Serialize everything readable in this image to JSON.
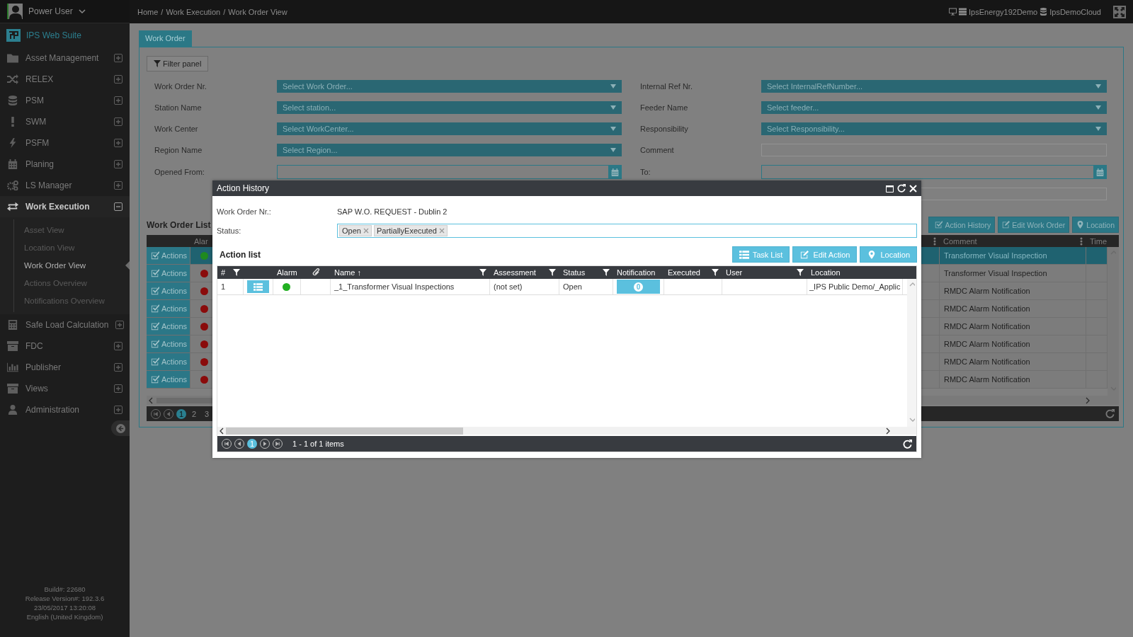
{
  "user": {
    "name": "Power User"
  },
  "app": {
    "name": "IPS Web Suite"
  },
  "sidebar": {
    "items": [
      {
        "label": "Asset Management",
        "expanded": false
      },
      {
        "label": "RELEX",
        "expanded": false
      },
      {
        "label": "PSM",
        "expanded": false
      },
      {
        "label": "SWM",
        "expanded": false
      },
      {
        "label": "PSFM",
        "expanded": false
      },
      {
        "label": "Planing",
        "expanded": false
      },
      {
        "label": "LS Manager",
        "expanded": false
      },
      {
        "label": "Work Execution",
        "expanded": true,
        "children": [
          {
            "label": "Asset View",
            "selected": false
          },
          {
            "label": "Location View",
            "selected": false
          },
          {
            "label": "Work Order View",
            "selected": true
          },
          {
            "label": "Actions Overview",
            "selected": false
          },
          {
            "label": "Notifications Overview",
            "selected": false
          }
        ]
      },
      {
        "label": "Safe Load Calculation",
        "expanded": false
      },
      {
        "label": "FDC",
        "expanded": false
      },
      {
        "label": "Publisher",
        "expanded": false
      },
      {
        "label": "Views",
        "expanded": false
      },
      {
        "label": "Administration",
        "expanded": false
      }
    ]
  },
  "footer": [
    "Build#: 22680",
    "Release Version#: 192.3.6",
    "23/05/2017 13:20:08",
    "English (United Kingdom)"
  ],
  "breadcrumb": [
    {
      "label": "Home",
      "separator": "/"
    },
    {
      "label": "Work Execution",
      "separator": "/"
    },
    {
      "label": "Work Order View"
    }
  ],
  "environment": {
    "client": "IpsEnergy192Demo",
    "database": "IpsDemoCloud"
  },
  "tabs": [
    {
      "label": "Work Order",
      "selected": true
    }
  ],
  "filter_panel": {
    "button": "Filter panel",
    "rows": [
      {
        "left": {
          "label": "Work Order Nr.",
          "kind": "select",
          "placeholder": "Select Work Order..."
        },
        "right": {
          "label": "Internal Ref Nr.",
          "kind": "select",
          "placeholder": "Select InternalRefNumber..."
        }
      },
      {
        "left": {
          "label": "Station Name",
          "kind": "select",
          "placeholder": "Select station..."
        },
        "right": {
          "label": "Feeder Name",
          "kind": "select",
          "placeholder": "Select feeder..."
        }
      },
      {
        "left": {
          "label": "Work Center",
          "kind": "select",
          "placeholder": "Select WorkCenter..."
        },
        "right": {
          "label": "Responsibility",
          "kind": "select",
          "placeholder": "Select Responsibility..."
        }
      },
      {
        "left": {
          "label": "Region Name",
          "kind": "select",
          "placeholder": "Select Region..."
        },
        "right": {
          "label": "Comment",
          "kind": "text"
        }
      },
      {
        "left": {
          "label": "Opened From:",
          "kind": "date"
        },
        "right": {
          "label": "To:",
          "kind": "date"
        }
      },
      {
        "right": {
          "kind": "text"
        }
      }
    ]
  },
  "work_order_list": {
    "title": "Work Order List",
    "buttons": [
      "Action History",
      "Edit Work Order",
      "Location"
    ],
    "columns": [
      {
        "label": "Alar"
      },
      {
        "label": "Comment"
      },
      {
        "label": "Time"
      }
    ],
    "rows": [
      {
        "action": "Actions",
        "color": "#1f8a1f",
        "comment": "Transformer Visual Inspection",
        "selected": true
      },
      {
        "action": "Actions",
        "color": "#8a0b0b",
        "comment": "Transformer Visual Inspection",
        "selected": false
      },
      {
        "action": "Actions",
        "color": "#8a0b0b",
        "comment": "RMDC Alarm Notification",
        "selected": false
      },
      {
        "action": "Actions",
        "color": "#8a0b0b",
        "comment": "RMDC Alarm Notification",
        "selected": false
      },
      {
        "action": "Actions",
        "color": "#8a0b0b",
        "comment": "RMDC Alarm Notification",
        "selected": false
      },
      {
        "action": "Actions",
        "color": "#8a0b0b",
        "comment": "RMDC Alarm Notification",
        "selected": false
      },
      {
        "action": "Actions",
        "color": "#8a0b0b",
        "comment": "RMDC Alarm Notification",
        "selected": false
      },
      {
        "action": "Actions",
        "color": "#8a0b0b",
        "comment": "RMDC Alarm Notification",
        "selected": false
      }
    ],
    "pager": {
      "pages": [
        {
          "label": "1",
          "selected": true
        },
        {
          "label": "2",
          "selected": false
        },
        {
          "label": "3",
          "selected": false
        }
      ]
    }
  },
  "dialog": {
    "title": "Action History",
    "work_order_label": "Work Order Nr.:",
    "work_order_value": "SAP W.O. REQUEST - Dublin 2",
    "status_label": "Status:",
    "status_tags": [
      "Open",
      "PartiallyExecuted"
    ],
    "action_list": {
      "title": "Action list",
      "buttons": [
        "Task List",
        "Edit Action",
        "Location"
      ],
      "columns": [
        {
          "kind": "text",
          "label": "#",
          "filter": true
        },
        {
          "kind": "blank"
        },
        {
          "kind": "text",
          "label": "Alarm",
          "filter": false
        },
        {
          "kind": "attachment"
        },
        {
          "kind": "text",
          "label": "Name",
          "sort_mark": "↑",
          "filter": true
        },
        {
          "kind": "text",
          "label": "Assessment",
          "filter": true
        },
        {
          "kind": "text",
          "label": "Status",
          "filter": true
        },
        {
          "kind": "text",
          "label": "Notification",
          "filter": false
        },
        {
          "kind": "text",
          "label": "Executed",
          "filter": true
        },
        {
          "kind": "text",
          "label": "User",
          "filter": true
        },
        {
          "kind": "text",
          "label": "Location",
          "filter": false
        }
      ],
      "rows": [
        {
          "number": "1",
          "color": "#22b022",
          "name": "_1_Transformer Visual Inspections",
          "assessment": "(not set)",
          "status": "Open",
          "notification": "0",
          "location": "_IPS Public Demo/_Applic"
        }
      ],
      "pager": {
        "pages": [
          {
            "label": "1",
            "selected": true
          }
        ],
        "summary": "1 - 1 of 1 items"
      }
    }
  }
}
